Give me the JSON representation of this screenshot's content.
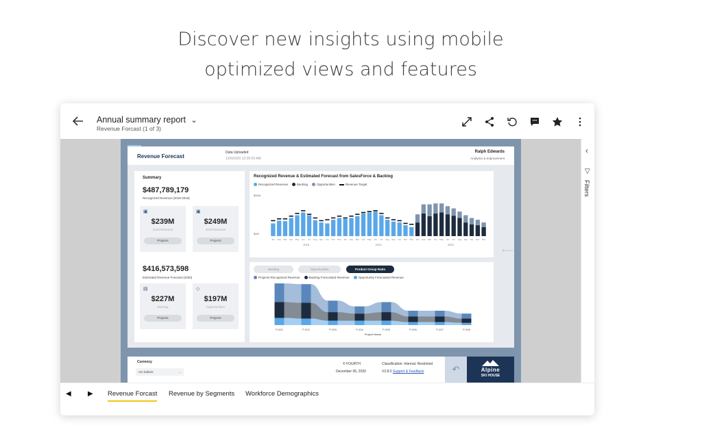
{
  "headline": {
    "line1": "Discover new insights using mobile",
    "line2": "optimized views and features"
  },
  "topbar": {
    "title": "Annual summary report",
    "subtitle": "Revenue Forcast (1 of 3)",
    "icons": [
      "back-arrow-icon",
      "chevron-down-icon",
      "expand-icon",
      "share-icon",
      "reset-icon",
      "comment-icon",
      "star-icon",
      "more-icon"
    ]
  },
  "filters_pane": {
    "label": "Filters"
  },
  "report": {
    "title": "Revenue Forecast",
    "data_uploaded_label": "Data Uploaded",
    "data_uploaded_value": "12/6/2020 12:00:00 AM",
    "user_name": "Ralph Edwards",
    "user_role": "Analytics & Improvement",
    "summary": {
      "heading": "Summary",
      "recognized_value": "$487,789,179",
      "recognized_label": "Recognized Revenue (2018-2019)",
      "estimated_value": "$416,573,598",
      "estimated_label": "Estimated Revenue Forecast (2020)",
      "kpis": [
        {
          "value": "$239M",
          "label": "2018 Revenue",
          "button": "Projects",
          "icon": "money-icon"
        },
        {
          "value": "$249M",
          "label": "2019 Revenue",
          "button": "Projects",
          "icon": "money-icon"
        },
        {
          "value": "$227M",
          "label": "Backlog",
          "button": "Projects",
          "icon": "document-icon"
        },
        {
          "value": "$197M",
          "label": "Opportunities",
          "button": "Projects",
          "icon": "diamond-icon"
        }
      ]
    },
    "pills": [
      "Backlog",
      "Opportunities",
      "Product Group Ratio"
    ],
    "footer": {
      "currency_label": "Currency",
      "currency_value": "US Dollars",
      "copyright": "© FOURTH",
      "date": "December 06, 2020",
      "classification": "Classification: Internal, Restricted",
      "version": "V2.8.0",
      "support_link": "Support & Feedback",
      "logo_line1": "Alpine",
      "logo_line2": "SKI HOUSE"
    }
  },
  "colors": {
    "light_blue": "#5aa7e8",
    "dark_navy": "#1d2b3e",
    "slate": "#7f94ad",
    "mid_blue": "#5a87bb",
    "tab_underline": "#f2c811"
  },
  "chart_data": [
    {
      "type": "bar",
      "title": "Recognized Revenue & Estimated Forecast from SalesForce & Backlog",
      "legend": [
        "Recognized Revenue",
        "Backlog",
        "Opportunities",
        "Revenue Target"
      ],
      "y_ticks": [
        "$90M",
        "$0M"
      ],
      "x_groups": [
        "2018",
        "2019",
        "2020"
      ],
      "month_labels": [
        "Jan",
        "Feb",
        "Mar",
        "Apr",
        "May",
        "Jun",
        "Jul",
        "Aug",
        "Sep",
        "Oct",
        "Nov",
        "Dec",
        "Jan",
        "Feb",
        "Mar",
        "Apr",
        "May",
        "Jun",
        "Jul",
        "Aug",
        "Sep",
        "Oct",
        "Nov",
        "Dec",
        "Jan",
        "Feb",
        "Mar",
        "Apr",
        "May",
        "Jun",
        "Jul",
        "Aug",
        "Sep",
        "Oct",
        "Nov",
        "Dec"
      ],
      "series": [
        {
          "name": "Recognized Revenue",
          "values": [
            28,
            34,
            33,
            40,
            46,
            52,
            46,
            35,
            30,
            28,
            36,
            40,
            38,
            40,
            44,
            50,
            52,
            54,
            46,
            36,
            32,
            30,
            24,
            20,
            0,
            0,
            0,
            0,
            0,
            0,
            0,
            0,
            0,
            0,
            0,
            0
          ]
        },
        {
          "name": "Backlog",
          "values": [
            0,
            0,
            0,
            0,
            0,
            0,
            0,
            0,
            0,
            0,
            0,
            0,
            0,
            0,
            0,
            0,
            0,
            0,
            0,
            0,
            0,
            0,
            0,
            0,
            30,
            50,
            44,
            50,
            52,
            48,
            45,
            40,
            30,
            26,
            24,
            20
          ]
        },
        {
          "name": "Opportunities",
          "values": [
            0,
            0,
            0,
            0,
            0,
            0,
            0,
            0,
            0,
            0,
            0,
            0,
            0,
            0,
            0,
            0,
            0,
            0,
            0,
            0,
            0,
            0,
            0,
            0,
            18,
            20,
            26,
            22,
            20,
            18,
            16,
            14,
            16,
            14,
            12,
            10
          ]
        },
        {
          "name": "Revenue Target",
          "values": [
            34,
            38,
            38,
            44,
            50,
            56,
            48,
            40,
            34,
            36,
            40,
            44,
            40,
            44,
            48,
            52,
            54,
            56,
            50,
            40,
            36,
            34,
            28,
            26,
            0,
            0,
            0,
            0,
            0,
            0,
            0,
            0,
            0,
            0,
            0,
            0
          ]
        }
      ],
      "ylim": [
        0,
        95
      ]
    },
    {
      "type": "area",
      "legend": [
        "Projects Recognized Revenue",
        "Backlog Forecasted Revenue",
        "Opportunity Forecasted Revenue"
      ],
      "categories": [
        "P-001",
        "P-002",
        "P-003",
        "P-004",
        "P-005",
        "P-006",
        "P-007",
        "P-008"
      ],
      "xlabel": "Project Name",
      "series": [
        {
          "name": "Projects Recognized Revenue",
          "values": [
            26,
            26,
            16,
            10,
            14,
            8,
            8,
            7
          ]
        },
        {
          "name": "Backlog Forecasted Revenue",
          "values": [
            22,
            22,
            12,
            10,
            12,
            8,
            8,
            6
          ]
        },
        {
          "name": "Opportunity Forecasted Revenue",
          "values": [
            10,
            9,
            6,
            6,
            6,
            4,
            4,
            3
          ]
        }
      ]
    }
  ],
  "bottom_tabs": [
    {
      "label": "Revenue Forcast",
      "active": true
    },
    {
      "label": "Revenue by Segments",
      "active": false
    },
    {
      "label": "Workforce Demographics",
      "active": false
    }
  ]
}
